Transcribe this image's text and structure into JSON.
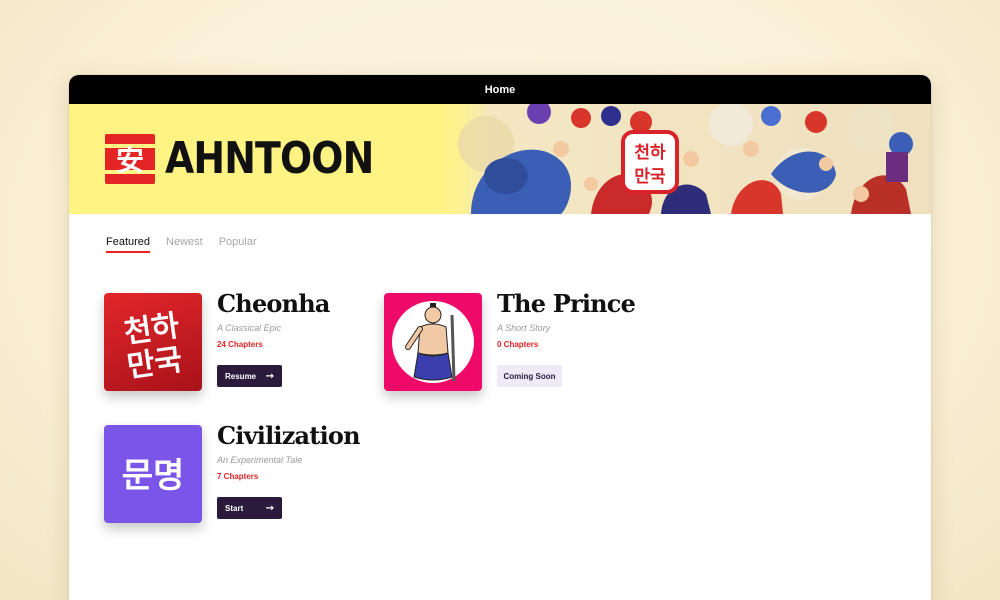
{
  "window": {
    "title": "Home"
  },
  "brand": {
    "mark": "安",
    "name": "AHNTOON",
    "banner_art_text": "천하만국"
  },
  "tabs": [
    {
      "label": "Featured",
      "active": true
    },
    {
      "label": "Newest",
      "active": false
    },
    {
      "label": "Popular",
      "active": false
    }
  ],
  "series": [
    {
      "title": "Cheonha",
      "subtitle": "A Classical Epic",
      "chapters": "24 Chapters",
      "button": "Resume",
      "cover_text": "천하\n만국",
      "cover_color": "#c8161d"
    },
    {
      "title": "The Prince",
      "subtitle": "A Short Story",
      "chapters": "0 Chapters",
      "button": "Coming Soon",
      "cover_color": "#ef0a6a"
    },
    {
      "title": "Civilization",
      "subtitle": "An Experimental Tale",
      "chapters": "7 Chapters",
      "button": "Start",
      "cover_text": "문명",
      "cover_color": "#7a55e8"
    }
  ],
  "colors": {
    "accent": "#e52525",
    "banner": "#fff384",
    "button_dark": "#2a1b3d"
  }
}
